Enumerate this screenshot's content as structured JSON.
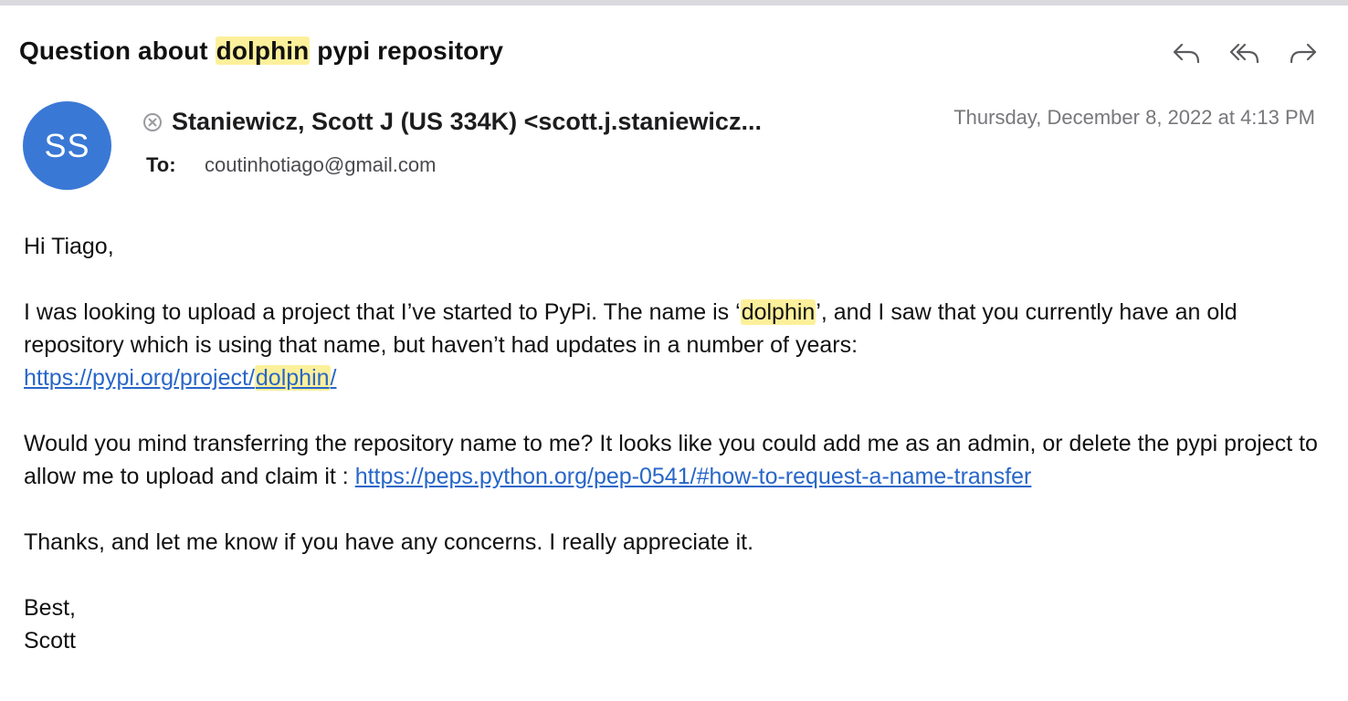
{
  "email": {
    "subject": {
      "before": "Question about ",
      "highlight": "dolphin",
      "after": " pypi repository"
    },
    "actions": [
      {
        "name": "reply",
        "icon": "reply-icon"
      },
      {
        "name": "reply-all",
        "icon": "reply-all-icon"
      },
      {
        "name": "forward",
        "icon": "forward-icon"
      }
    ],
    "avatar_initials": "SS",
    "avatar_color": "#3a78d6",
    "sender": "Staniewicz, Scott J (US 334K) <scott.j.staniewicz...",
    "sender_status_icon": "x-circle-icon",
    "date": "Thursday, December 8, 2022 at 4:13 PM",
    "to_label": "To:",
    "to_address": "coutinhotiago@gmail.com",
    "highlight_color": "#fdf09b",
    "link_color": "#2866c8"
  },
  "message": {
    "greeting": "Hi Tiago,",
    "p1": {
      "text1": "I was looking to upload a project that I’ve started to PyPi. The name is ‘",
      "highlight": "dolphin",
      "text2": "’, and I saw that you currently have an old repository which is using that name, but haven’t had updates in a number of years:",
      "link_before": "https://pypi.org/project/",
      "link_highlight": "dolphin",
      "link_after": "/"
    },
    "p2": {
      "text": "Would you mind transferring the repository name to me? It looks like you could add me as an admin, or delete the pypi project to allow me to upload and claim it : ",
      "link": "https://peps.python.org/pep-0541/#how-to-request-a-name-transfer"
    },
    "p3": "Thanks, and let me know if you have any concerns. I really appreciate it.",
    "signoff": "Best,",
    "signature": "Scott"
  }
}
